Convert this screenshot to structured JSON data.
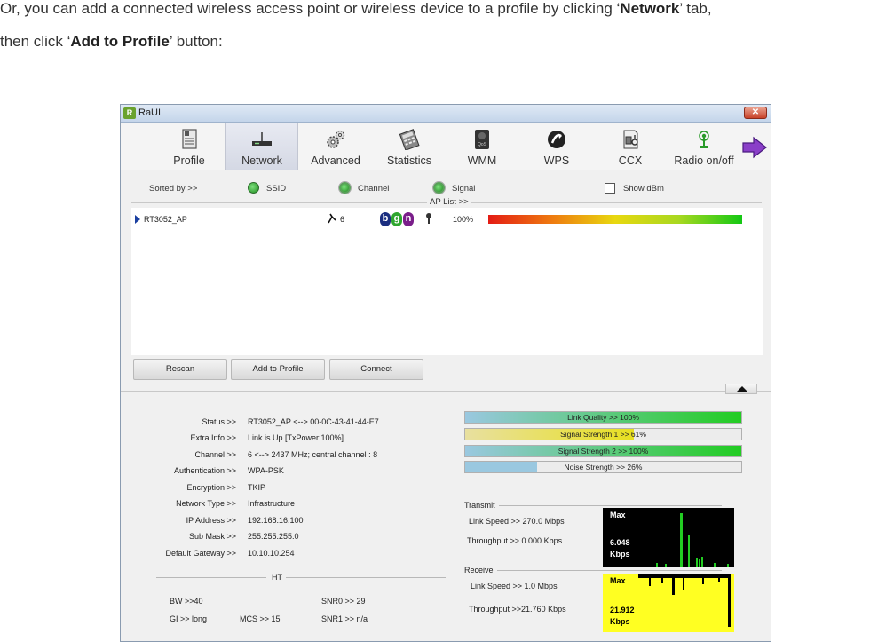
{
  "instructions": {
    "line1_prefix": "Or, you can add a connected wireless access point or wireless device to a profile by clicking ‘",
    "line1_bold": "Network",
    "line1_suffix": "’ tab,",
    "line2_prefix": "then click ‘",
    "line2_bold": "Add to Profile",
    "line2_suffix": "’ button:"
  },
  "window": {
    "title": "RaUI",
    "logo_letter": "R"
  },
  "toolbar": {
    "items": [
      {
        "label": "Profile",
        "icon": "profile-icon",
        "active": false
      },
      {
        "label": "Network",
        "icon": "network-icon",
        "active": true
      },
      {
        "label": "Advanced",
        "icon": "gears-icon",
        "active": false
      },
      {
        "label": "Statistics",
        "icon": "calculator-icon",
        "active": false
      },
      {
        "label": "WMM",
        "icon": "qos-icon",
        "active": false
      },
      {
        "label": "WPS",
        "icon": "wps-icon",
        "active": false
      },
      {
        "label": "CCX",
        "icon": "ccx-icon",
        "active": false
      },
      {
        "label": "Radio on/off",
        "icon": "antenna-icon",
        "active": false
      }
    ]
  },
  "sort": {
    "label": "Sorted by >>",
    "options": [
      "SSID",
      "Channel",
      "Signal"
    ],
    "show_dbm": "Show dBm",
    "list_title": "AP List >>"
  },
  "ap_list": [
    {
      "ssid": "RT3052_AP",
      "channel": "6",
      "modes": [
        "b",
        "g",
        "n"
      ],
      "signal": "100%",
      "signal_value": 100
    }
  ],
  "buttons": {
    "rescan": "Rescan",
    "add_to_profile": "Add to Profile",
    "connect": "Connect"
  },
  "status": {
    "rows": [
      {
        "key": "Status >>",
        "value": "RT3052_AP <--> 00-0C-43-41-44-E7"
      },
      {
        "key": "Extra Info >>",
        "value": "Link is Up [TxPower:100%]"
      },
      {
        "key": "Channel >>",
        "value": "6 <--> 2437 MHz; central channel : 8"
      },
      {
        "key": "Authentication >>",
        "value": "WPA-PSK"
      },
      {
        "key": "Encryption >>",
        "value": "TKIP"
      },
      {
        "key": "Network Type >>",
        "value": "Infrastructure"
      },
      {
        "key": "IP Address >>",
        "value": "192.168.16.100"
      },
      {
        "key": "Sub Mask >>",
        "value": "255.255.255.0"
      },
      {
        "key": "Default Gateway >>",
        "value": "10.10.10.254"
      }
    ]
  },
  "quality": [
    {
      "label": "Link Quality >> 100%",
      "value": 100
    },
    {
      "label": "Signal Strength 1 >> 61%",
      "value": 61
    },
    {
      "label": "Signal Strength 2 >> 100%",
      "value": 100
    },
    {
      "label": "Noise Strength >> 26%",
      "value": 26
    }
  ],
  "transmit": {
    "title": "Transmit",
    "link_speed": "Link Speed >>  270.0 Mbps",
    "throughput": "Throughput >> 0.000 Kbps",
    "graph_max": "Max",
    "graph_value": "6.048",
    "graph_unit": "Kbps"
  },
  "receive": {
    "title": "Receive",
    "link_speed": "Link Speed >> 1.0 Mbps",
    "throughput": "Throughput >>21.760 Kbps",
    "graph_max": "Max",
    "graph_value": "21.912",
    "graph_unit": "Kbps"
  },
  "ht": {
    "title": "HT",
    "bw": "BW >>40",
    "gi": "GI >>  long",
    "mcs": "MCS >>   15",
    "snr0": "SNR0 >>  29",
    "snr1": "SNR1 >>  n/a"
  },
  "colors": {
    "selected_tab_bg": "#d8dbe6",
    "link_quality": "#22cc22",
    "tx_graph_bg": "#000000",
    "tx_graph_bars": "#22cc22",
    "rx_graph_bg": "#ffff22",
    "rx_graph_bars": "#000000"
  }
}
